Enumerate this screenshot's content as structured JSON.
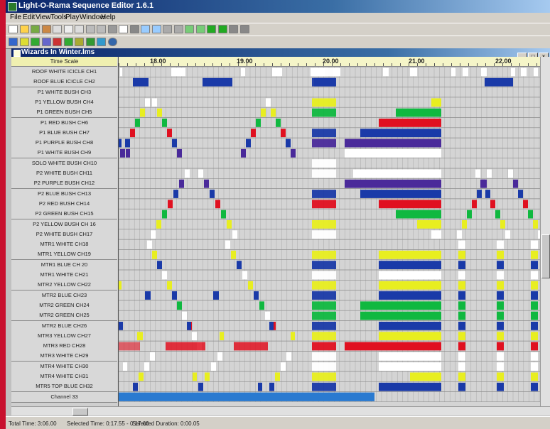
{
  "window": {
    "title": "Light-O-Rama Sequence Editor 1.6.1"
  },
  "menu": [
    "File",
    "Edit",
    "View",
    "Tools",
    "Play",
    "Window",
    "Help"
  ],
  "document": {
    "title": "Wizards In Winter.lms",
    "timescale_label": "Time Scale"
  },
  "ruler": {
    "labels": [
      "18.00",
      "19.00",
      "20.00",
      "21.00",
      "22.00"
    ]
  },
  "channels": [
    "ROOF WHITE ICICLE CH1",
    "ROOF BLUE ICICLE CH2",
    "P1 WHITE BUSH CH3",
    "P1 YELLOW BUSH CH4",
    "P1 GREEN BUSH CH5",
    "P1 RED BUSH CH6",
    "P1 BLUE BUSH CH7",
    "P1 PURPLE BUSH CH8",
    "P1 WHITE BUSH CH9",
    "SOLO WHITE BUSH CH10",
    "P2 WHITE BUSH CH11",
    "P2 PURPLE BUSH CH12",
    "P2 BLUE BUSH CH13",
    "P2 RED BUSH CH14",
    "P2 GREEN BUSH CH15",
    "P2 YELLOW BUSH CH 16",
    "P2 WHITE BUSH CH17",
    "MTR1 WHITE CH18",
    "MTR1 YELLOW CH19",
    "MTR1 BLUE CH 20",
    "MTR1 WHITE CH21",
    "MTR2 YELLOW CH22",
    "MTR2 BLUE CH23",
    "MTR2 GREEN CH24",
    "MTR2 GREEN CH25",
    "MTR2 BLUE CH26",
    "MTR3 YELLOW CH27",
    "MTR3 RED CH28",
    "MTR3 WHITE CH29",
    "MTR4 WHITE CH30",
    "MTR4 WHITE CH31",
    "MTR5 TOP BLUE CH32",
    "Channel 33"
  ],
  "status": {
    "total_time": "Total Time: 3:06.00",
    "selected_time": "Selected Time: 0:17.55 - 0:17.60",
    "selected_duration": "Selected Duration: 0:00.05"
  },
  "colors": {
    "white": "#ffffff",
    "blue": "#1a3aa8",
    "purple": "#4a2a9a",
    "red": "#e01020",
    "green": "#10b840",
    "yellow": "#e8ee20",
    "grid_bg": "#d4d4d4",
    "grid_line": "#a8a8a8",
    "accent_title": "#0a246a"
  },
  "icons": {
    "toolbar1": [
      "new-icon",
      "open-icon",
      "save-icon",
      "save-as-icon",
      "cut-icon",
      "copy-icon",
      "paste-icon",
      "undo-icon",
      "redo-icon",
      "select-icon",
      "on-icon",
      "off-icon",
      "fade-up-icon",
      "fade-down-icon",
      "shimmer-icon",
      "twinkle-icon",
      "zoom-in-icon",
      "zoom-out-icon",
      "play-icon",
      "play-from-icon",
      "pause-icon",
      "stop-icon"
    ],
    "toolbar2": [
      "tool-a-icon",
      "tool-b-icon",
      "tool-c-icon",
      "tool-d-icon",
      "tool-e-icon",
      "tool-f-icon",
      "tool-g-icon",
      "tool-h-icon",
      "tool-i-icon",
      "help-icon"
    ]
  }
}
